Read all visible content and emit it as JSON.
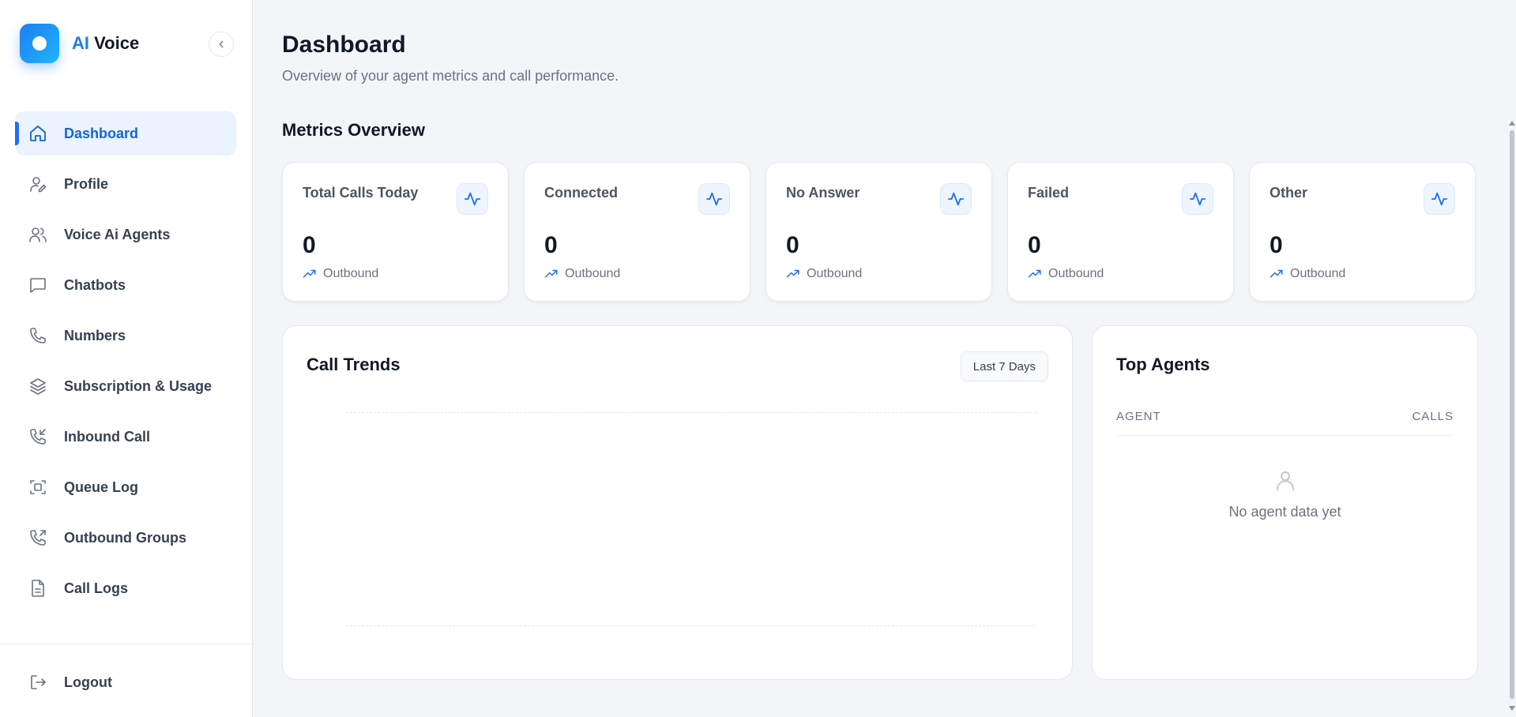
{
  "brand": {
    "accent": "AI",
    "name": "Voice",
    "accent_color": "#1d7cf2"
  },
  "sidebar": {
    "items": [
      {
        "label": "Dashboard",
        "icon": "home-icon",
        "active": true
      },
      {
        "label": "Profile",
        "icon": "user-edit-icon"
      },
      {
        "label": "Voice Ai Agents",
        "icon": "users-icon"
      },
      {
        "label": "Chatbots",
        "icon": "chat-icon"
      },
      {
        "label": "Numbers",
        "icon": "phone-icon"
      },
      {
        "label": "Subscription & Usage",
        "icon": "layers-icon"
      },
      {
        "label": "Inbound Call",
        "icon": "phone-incoming-icon"
      },
      {
        "label": "Queue Log",
        "icon": "scan-icon"
      },
      {
        "label": "Outbound Groups",
        "icon": "phone-outgoing-icon"
      },
      {
        "label": "Call Logs",
        "icon": "file-icon"
      }
    ],
    "logout": "Logout"
  },
  "header": {
    "title": "Dashboard",
    "subtitle": "Overview of your agent metrics and call performance."
  },
  "metrics": {
    "title": "Metrics Overview",
    "cards": [
      {
        "label": "Total Calls Today",
        "value": "0",
        "sub": "Outbound"
      },
      {
        "label": "Connected",
        "value": "0",
        "sub": "Outbound"
      },
      {
        "label": "No Answer",
        "value": "0",
        "sub": "Outbound"
      },
      {
        "label": "Failed",
        "value": "0",
        "sub": "Outbound"
      },
      {
        "label": "Other",
        "value": "0",
        "sub": "Outbound"
      }
    ]
  },
  "trends": {
    "title": "Call Trends",
    "range": "Last 7 Days"
  },
  "agents": {
    "title": "Top Agents",
    "col_agent": "AGENT",
    "col_calls": "CALLS",
    "empty": "No agent data yet"
  }
}
